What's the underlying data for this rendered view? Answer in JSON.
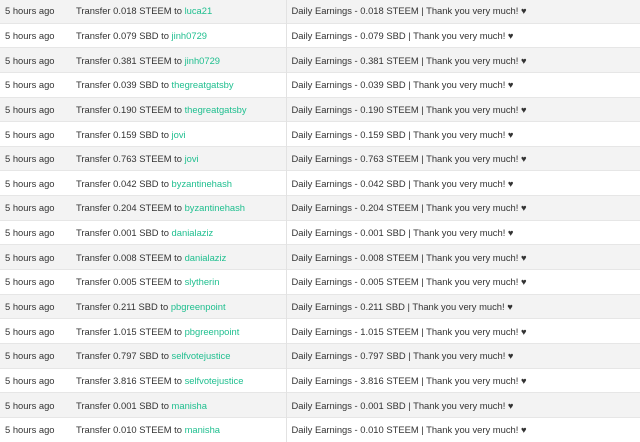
{
  "history": {
    "rows": [
      {
        "time": "5 hours ago",
        "op_prefix": "Transfer 0.018 STEEM to",
        "account": "luca21",
        "memo": "Daily Earnings - 0.018 STEEM | Thank you very much! ♥"
      },
      {
        "time": "5 hours ago",
        "op_prefix": "Transfer 0.079 SBD to",
        "account": "jinh0729",
        "memo": "Daily Earnings - 0.079 SBD | Thank you very much! ♥"
      },
      {
        "time": "5 hours ago",
        "op_prefix": "Transfer 0.381 STEEM to",
        "account": "jinh0729",
        "memo": "Daily Earnings - 0.381 STEEM | Thank you very much! ♥"
      },
      {
        "time": "5 hours ago",
        "op_prefix": "Transfer 0.039 SBD to",
        "account": "thegreatgatsby",
        "memo": "Daily Earnings - 0.039 SBD | Thank you very much! ♥"
      },
      {
        "time": "5 hours ago",
        "op_prefix": "Transfer 0.190 STEEM to",
        "account": "thegreatgatsby",
        "memo": "Daily Earnings - 0.190 STEEM | Thank you very much! ♥"
      },
      {
        "time": "5 hours ago",
        "op_prefix": "Transfer 0.159 SBD to",
        "account": "jovi",
        "memo": "Daily Earnings - 0.159 SBD | Thank you very much! ♥"
      },
      {
        "time": "5 hours ago",
        "op_prefix": "Transfer 0.763 STEEM to",
        "account": "jovi",
        "memo": "Daily Earnings - 0.763 STEEM | Thank you very much! ♥"
      },
      {
        "time": "5 hours ago",
        "op_prefix": "Transfer 0.042 SBD to",
        "account": "byzantinehash",
        "memo": "Daily Earnings - 0.042 SBD | Thank you very much! ♥"
      },
      {
        "time": "5 hours ago",
        "op_prefix": "Transfer 0.204 STEEM to",
        "account": "byzantinehash",
        "memo": "Daily Earnings - 0.204 STEEM | Thank you very much! ♥"
      },
      {
        "time": "5 hours ago",
        "op_prefix": "Transfer 0.001 SBD to",
        "account": "danialaziz",
        "memo": "Daily Earnings - 0.001 SBD | Thank you very much! ♥"
      },
      {
        "time": "5 hours ago",
        "op_prefix": "Transfer 0.008 STEEM to",
        "account": "danialaziz",
        "memo": "Daily Earnings - 0.008 STEEM | Thank you very much! ♥"
      },
      {
        "time": "5 hours ago",
        "op_prefix": "Transfer 0.005 STEEM to",
        "account": "slytherin",
        "memo": "Daily Earnings - 0.005 STEEM | Thank you very much! ♥"
      },
      {
        "time": "5 hours ago",
        "op_prefix": "Transfer 0.211 SBD to",
        "account": "pbgreenpoint",
        "memo": "Daily Earnings - 0.211 SBD | Thank you very much! ♥"
      },
      {
        "time": "5 hours ago",
        "op_prefix": "Transfer 1.015 STEEM to",
        "account": "pbgreenpoint",
        "memo": "Daily Earnings - 1.015 STEEM | Thank you very much! ♥"
      },
      {
        "time": "5 hours ago",
        "op_prefix": "Transfer 0.797 SBD to",
        "account": "selfvotejustice",
        "memo": "Daily Earnings - 0.797 SBD | Thank you very much! ♥"
      },
      {
        "time": "5 hours ago",
        "op_prefix": "Transfer 3.816 STEEM to",
        "account": "selfvotejustice",
        "memo": "Daily Earnings - 3.816 STEEM | Thank you very much! ♥"
      },
      {
        "time": "5 hours ago",
        "op_prefix": "Transfer 0.001 SBD to",
        "account": "manisha",
        "memo": "Daily Earnings - 0.001 SBD | Thank you very much! ♥"
      },
      {
        "time": "5 hours ago",
        "op_prefix": "Transfer 0.010 STEEM to",
        "account": "manisha",
        "memo": "Daily Earnings - 0.010 STEEM | Thank you very much! ♥"
      }
    ]
  },
  "colors": {
    "link": "#1fbf8f",
    "row_stripe": "#f3f3f3",
    "text": "#333333"
  }
}
